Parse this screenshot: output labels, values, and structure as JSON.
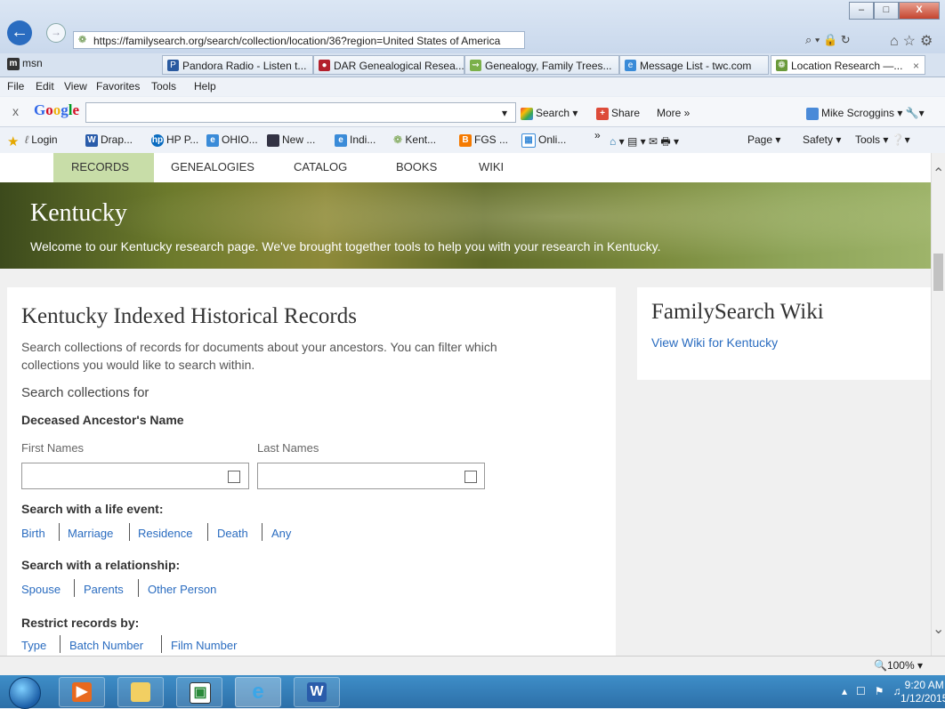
{
  "browser": {
    "url": "https://familysearch.org/search/collection/location/36?region=United States of America",
    "search_glyph": "⌕ ▾ 🔒 ↻",
    "home_fav_settings": "⌂☆⚙",
    "window_controls": {
      "minimize": "–",
      "maximize": "□",
      "close": "X"
    },
    "msn": "msn",
    "tabs": [
      {
        "label": "Pandora Radio - Listen t...",
        "active": false
      },
      {
        "label": "DAR Genealogical Resea...",
        "active": false
      },
      {
        "label": "Genealogy, Family Trees...",
        "active": false
      },
      {
        "label": "Message List - twc.com",
        "active": false
      },
      {
        "label": "Location Research —...",
        "active": true
      }
    ],
    "tab_close": "×",
    "menu": [
      "File",
      "Edit",
      "View",
      "Favorites",
      "Tools",
      "Help"
    ]
  },
  "google_toolbar": {
    "close": "x",
    "logo": "Google",
    "search_label": "Search",
    "share_label": "Share",
    "more_label": "More »",
    "user": "Mike Scroggins"
  },
  "favorites": {
    "items": [
      "Login",
      "Drap...",
      "HP P...",
      "OHIO...",
      "New ...",
      "Indi...",
      "Kent...",
      "FGS ...",
      "Onli..."
    ],
    "overflow": "»",
    "right_tools": [
      "Page",
      "Safety",
      "Tools"
    ]
  },
  "site_nav": [
    "RECORDS",
    "GENEALOGIES",
    "CATALOG",
    "BOOKS",
    "WIKI"
  ],
  "hero": {
    "title": "Kentucky",
    "subtitle": "Welcome to our Kentucky research page. We've brought together tools to help you with your research in Kentucky."
  },
  "records": {
    "heading": "Kentucky Indexed Historical Records",
    "description_line1": "Search collections of records for documents about your ancestors. You can filter which",
    "description_line2": "collections you would like to search within.",
    "search_for": "Search collections for",
    "deceased_label": "Deceased Ancestor's Name",
    "first_names": "First Names",
    "last_names": "Last Names",
    "life_event_label": "Search with a life event:",
    "life_events": [
      "Birth",
      "Marriage",
      "Residence",
      "Death",
      "Any"
    ],
    "relationship_label": "Search with a relationship:",
    "relationships": [
      "Spouse",
      "Parents",
      "Other Person"
    ],
    "restrict_label": "Restrict records by:",
    "restrictions": [
      "Type",
      "Batch Number",
      "Film Number"
    ]
  },
  "wiki": {
    "heading": "FamilySearch Wiki",
    "link": "View Wiki for Kentucky"
  },
  "status": {
    "zoom": "🔍100%"
  },
  "taskbar": {
    "time": "9:20 AM",
    "date": "1/12/2015"
  }
}
